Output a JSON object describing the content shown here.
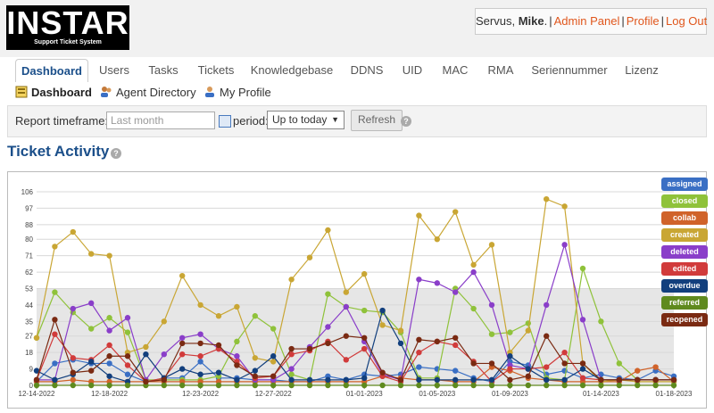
{
  "header": {
    "logo_main": "INSTAR",
    "logo_sub": "Support Ticket System",
    "greeting": "Servus,",
    "user_name": "Mike",
    "links": [
      "Admin Panel",
      "Profile",
      "Log Out"
    ]
  },
  "tabs": [
    "Dashboard",
    "Users",
    "Tasks",
    "Tickets",
    "Knowledgebase",
    "DDNS",
    "UID",
    "MAC",
    "RMA",
    "Seriennummer",
    "Lizenz"
  ],
  "subnav": [
    "Dashboard",
    "Agent Directory",
    "My Profile"
  ],
  "filter": {
    "timeframe_label": "Report timeframe:",
    "timeframe_placeholder": "Last month",
    "period_label": "period:",
    "period_value": "Up to today",
    "refresh_label": "Refresh"
  },
  "page_title": "Ticket Activity",
  "chart_data": {
    "type": "line",
    "title": "",
    "xlabel": "",
    "ylabel": "",
    "ylim": [
      0,
      106
    ],
    "yticks": [
      0,
      9,
      18,
      27,
      35,
      44,
      53,
      62,
      71,
      80,
      88,
      97,
      106
    ],
    "x": [
      "12-14-2022",
      "12-15-2022",
      "12-16-2022",
      "12-17-2022",
      "12-18-2022",
      "12-19-2022",
      "12-20-2022",
      "12-21-2022",
      "12-22-2022",
      "12-23-2022",
      "12-24-2022",
      "12-25-2022",
      "12-26-2022",
      "12-27-2022",
      "12-28-2022",
      "12-29-2022",
      "12-30-2022",
      "12-31-2022",
      "01-01-2023",
      "01-02-2023",
      "01-03-2023",
      "01-04-2023",
      "01-05-2023",
      "01-06-2023",
      "01-07-2023",
      "01-08-2023",
      "01-09-2023",
      "01-10-2023",
      "01-11-2023",
      "01-12-2023",
      "01-13-2023",
      "01-14-2023",
      "01-15-2023",
      "01-16-2023",
      "01-17-2023",
      "01-18-2023"
    ],
    "xtick_labels": [
      "12-14-2022",
      "12-18-2022",
      "12-23-2022",
      "12-27-2022",
      "01-01-2023",
      "01-05-2023",
      "01-09-2023",
      "01-14-2023",
      "01-18-2023"
    ],
    "xtick_indices": [
      0,
      4,
      9,
      13,
      18,
      22,
      26,
      31,
      35
    ],
    "legend_position": "right",
    "series": [
      {
        "name": "assigned",
        "color": "#3a6fc4",
        "values": [
          2,
          12,
          14,
          12,
          12,
          6,
          2,
          4,
          4,
          13,
          4,
          4,
          3,
          3,
          2,
          2,
          5,
          3,
          6,
          5,
          6,
          10,
          9,
          8,
          4,
          2,
          13,
          11,
          6,
          8,
          4,
          6,
          4,
          3,
          8,
          5
        ]
      },
      {
        "name": "closed",
        "color": "#8fc23a",
        "values": [
          26,
          51,
          40,
          31,
          37,
          29,
          3,
          3,
          3,
          3,
          5,
          24,
          38,
          31,
          6,
          3,
          50,
          43,
          41,
          40,
          29,
          4,
          4,
          53,
          42,
          28,
          29,
          34,
          4,
          3,
          64,
          35,
          12,
          3,
          3,
          3
        ]
      },
      {
        "name": "collab",
        "color": "#d0632a",
        "values": [
          2,
          2,
          3,
          2,
          2,
          2,
          2,
          2,
          2,
          2,
          2,
          2,
          2,
          2,
          2,
          2,
          2,
          2,
          2,
          5,
          4,
          3,
          3,
          2,
          2,
          10,
          8,
          4,
          3,
          2,
          2,
          2,
          2,
          8,
          10,
          2
        ]
      },
      {
        "name": "created",
        "color": "#c9a634",
        "values": [
          26,
          76,
          84,
          72,
          71,
          18,
          21,
          35,
          60,
          44,
          38,
          43,
          15,
          13,
          58,
          70,
          85,
          51,
          61,
          33,
          30,
          93,
          80,
          95,
          66,
          77,
          18,
          30,
          102,
          98,
          12,
          2,
          3,
          2,
          2,
          2
        ]
      },
      {
        "name": "deleted",
        "color": "#8a3ec9",
        "values": [
          3,
          3,
          42,
          45,
          30,
          37,
          3,
          17,
          26,
          28,
          20,
          16,
          3,
          3,
          9,
          21,
          32,
          43,
          24,
          6,
          3,
          58,
          56,
          51,
          62,
          44,
          11,
          9,
          44,
          77,
          36,
          3,
          3,
          3,
          3,
          3
        ]
      },
      {
        "name": "edited",
        "color": "#d13b3b",
        "values": [
          3,
          28,
          15,
          14,
          22,
          11,
          2,
          4,
          17,
          16,
          20,
          13,
          4,
          5,
          17,
          19,
          24,
          14,
          20,
          5,
          2,
          18,
          24,
          22,
          13,
          2,
          9,
          9,
          10,
          18,
          4,
          3,
          3,
          3,
          3,
          3
        ]
      },
      {
        "name": "overdue",
        "color": "#123f7d",
        "values": [
          8,
          3,
          6,
          13,
          5,
          2,
          17,
          4,
          9,
          6,
          7,
          3,
          8,
          16,
          3,
          3,
          3,
          3,
          4,
          41,
          23,
          3,
          3,
          3,
          3,
          3,
          16,
          9,
          3,
          3,
          9,
          3,
          3,
          3,
          3,
          3
        ]
      },
      {
        "name": "referred",
        "color": "#5f8a1e",
        "values": [
          0,
          0,
          0,
          0,
          0,
          0,
          0,
          0,
          0,
          0,
          0,
          0,
          0,
          0,
          0,
          0,
          0,
          0,
          0,
          0,
          0,
          0,
          0,
          0,
          0,
          0,
          0,
          0,
          0,
          0,
          0,
          0,
          0,
          0,
          0,
          0
        ]
      },
      {
        "name": "reopened",
        "color": "#7a2a12",
        "values": [
          3,
          36,
          7,
          8,
          16,
          16,
          2,
          3,
          23,
          23,
          22,
          11,
          5,
          5,
          20,
          20,
          23,
          27,
          26,
          7,
          3,
          25,
          24,
          26,
          12,
          12,
          3,
          5,
          27,
          12,
          12,
          3,
          3,
          3,
          3,
          3
        ]
      }
    ]
  }
}
